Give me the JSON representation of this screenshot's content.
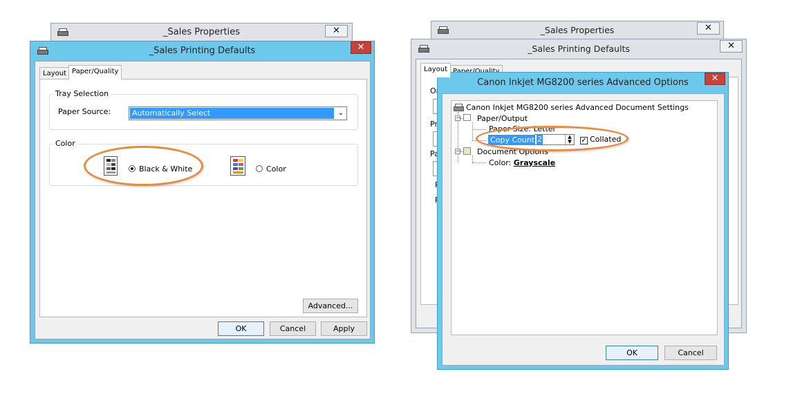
{
  "left": {
    "back_window": {
      "title": "_Sales Properties",
      "close": "✕"
    },
    "front_window": {
      "title": "_Sales Printing Defaults",
      "close": "✕",
      "tabs": [
        "Layout",
        "Paper/Quality"
      ],
      "tray_group": {
        "label": "Tray Selection",
        "paper_source_label": "Paper Source:",
        "paper_source_value": "Automatically Select"
      },
      "color_group": {
        "label": "Color",
        "bw_label": "Black & White",
        "color_label": "Color",
        "selected": "Black & White"
      },
      "advanced_button": "Advanced...",
      "buttons": {
        "ok": "OK",
        "cancel": "Cancel",
        "apply": "Apply"
      }
    }
  },
  "right": {
    "back_window": {
      "title": "_Sales Properties",
      "close": "✕"
    },
    "middle_window": {
      "title": "_Sales Printing Defaults",
      "close": "✕",
      "tabs": [
        "Layout",
        "Paper/Quality"
      ],
      "partial_labels": [
        "Or",
        "Pri",
        "Pa",
        "R",
        "P"
      ]
    },
    "dialog": {
      "title": "Canon Inkjet MG8200 series Advanced Options",
      "close": "✕",
      "tree": {
        "root": "Canon Inkjet MG8200 series Advanced Document Settings",
        "paper_output": "Paper/Output",
        "paper_size_label": "Paper Size:",
        "paper_size_value": "Letter",
        "copy_count_label": "Copy Count:",
        "copy_count_value": "2",
        "collated_label": "Collated",
        "collated_checked": true,
        "document_options": "Document Options",
        "color_label": "Color:",
        "color_value": "Grayscale"
      },
      "buttons": {
        "ok": "OK",
        "cancel": "Cancel"
      }
    }
  },
  "colors": {
    "highlight": "#e98a3c",
    "title_bar_active": "#6cc9ec",
    "selection": "#3399ff"
  }
}
